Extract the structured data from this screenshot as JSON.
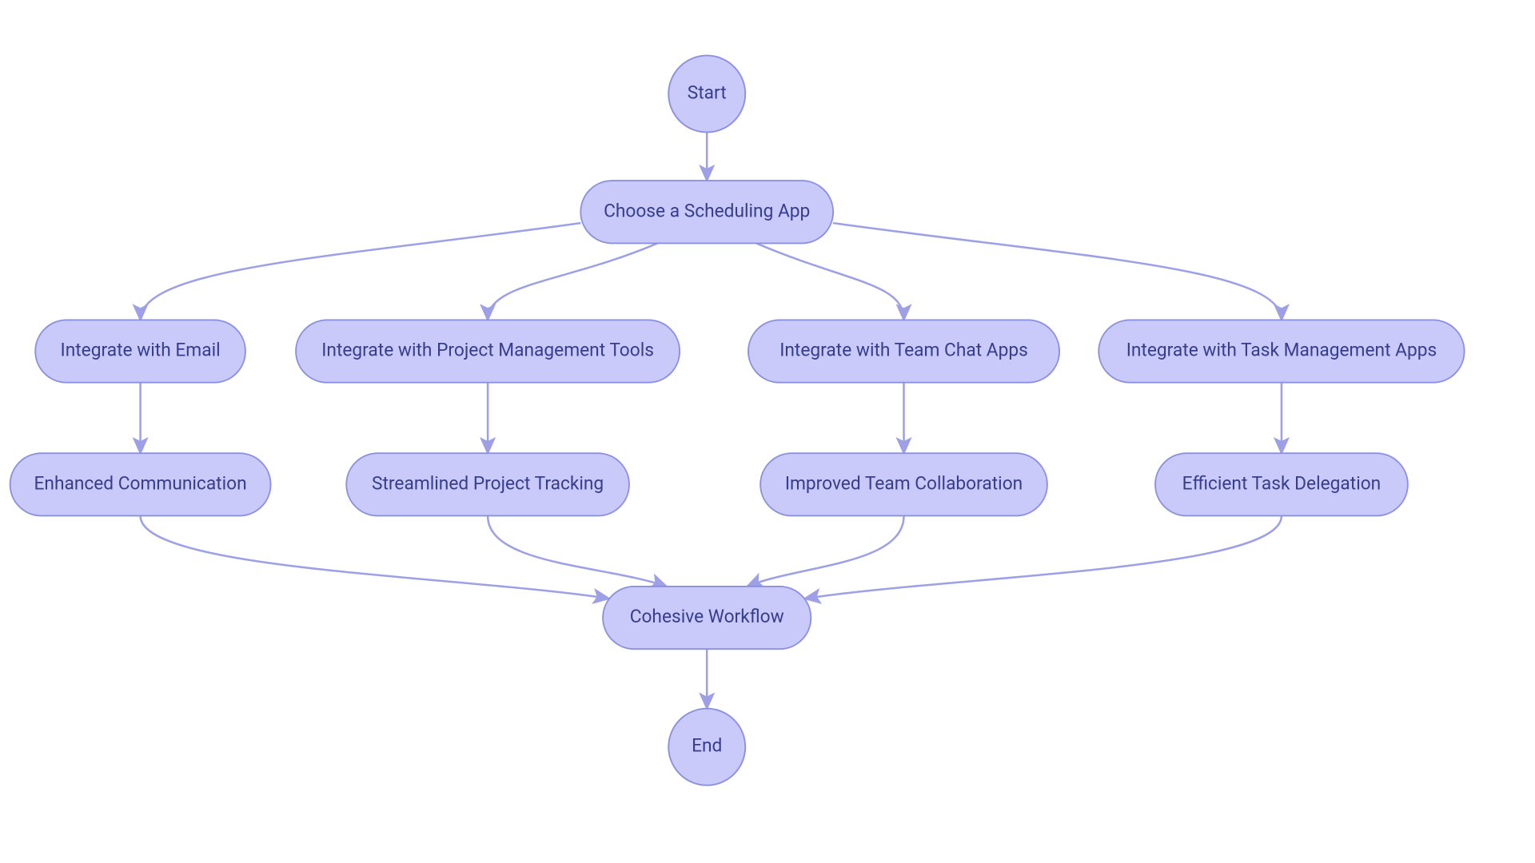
{
  "chart_data": {
    "type": "flowchart",
    "nodes": {
      "start": {
        "label": "Start"
      },
      "choose": {
        "label": "Choose a Scheduling App"
      },
      "int_email": {
        "label": "Integrate with Email"
      },
      "int_pm": {
        "label": "Integrate with Project Management Tools"
      },
      "int_chat": {
        "label": "Integrate with Team Chat Apps"
      },
      "int_task": {
        "label": "Integrate with Task Management Apps"
      },
      "out_email": {
        "label": "Enhanced Communication"
      },
      "out_pm": {
        "label": "Streamlined Project Tracking"
      },
      "out_chat": {
        "label": "Improved Team Collaboration"
      },
      "out_task": {
        "label": "Efficient Task Delegation"
      },
      "cohesive": {
        "label": "Cohesive Workflow"
      },
      "end": {
        "label": "End"
      }
    },
    "edges": [
      [
        "start",
        "choose"
      ],
      [
        "choose",
        "int_email"
      ],
      [
        "choose",
        "int_pm"
      ],
      [
        "choose",
        "int_chat"
      ],
      [
        "choose",
        "int_task"
      ],
      [
        "int_email",
        "out_email"
      ],
      [
        "int_pm",
        "out_pm"
      ],
      [
        "int_chat",
        "out_chat"
      ],
      [
        "int_task",
        "out_task"
      ],
      [
        "out_email",
        "cohesive"
      ],
      [
        "out_pm",
        "cohesive"
      ],
      [
        "out_chat",
        "cohesive"
      ],
      [
        "out_task",
        "cohesive"
      ],
      [
        "cohesive",
        "end"
      ]
    ],
    "colors": {
      "node_fill": "#c9caf9",
      "node_stroke": "#8c90e2",
      "text": "#363d8f",
      "edge": "#9da0e6"
    }
  }
}
